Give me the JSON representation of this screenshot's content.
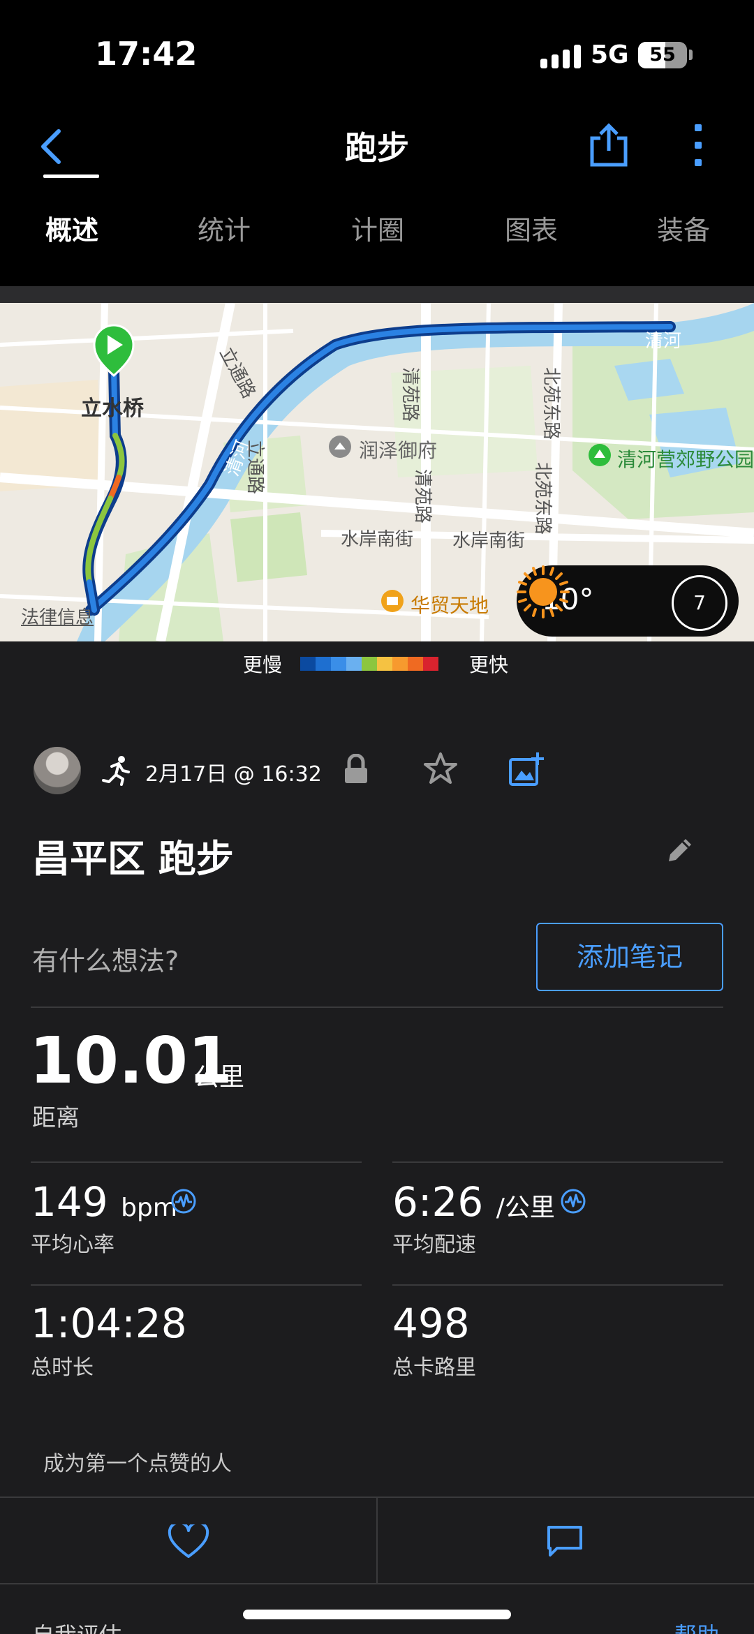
{
  "status_bar": {
    "time": "17:42",
    "network": "5G",
    "battery": "55",
    "battery_level": 0.55
  },
  "header": {
    "title": "跑步"
  },
  "tabs": [
    {
      "label": "概述",
      "active": true
    },
    {
      "label": "统计",
      "active": false
    },
    {
      "label": "计圈",
      "active": false
    },
    {
      "label": "图表",
      "active": false
    },
    {
      "label": "装备",
      "active": false
    }
  ],
  "map": {
    "labels": {
      "lishuiqiao": "立水桥",
      "litong_road": "立通路",
      "runze": "润泽御府",
      "qingyuan_road_1": "清苑路",
      "qingyuan_road_2": "清苑路",
      "beiyuan_east_road": "北苑东路",
      "beiyuan_east_road_2": "北苑东路",
      "qinghe_park": "清河营郊野公园",
      "shuian_south_1": "水岸南街",
      "shuian_south_2": "水岸南街",
      "huamao": "华贸天地",
      "qinghe_1": "清河",
      "qinghe_2": "清河",
      "legal": "法律信息",
      "litong_road_2": "立通路"
    },
    "weather": {
      "temperature": "10°",
      "icon": "sun-icon",
      "wind": "7"
    }
  },
  "legend": {
    "slower": "更慢",
    "faster": "更快",
    "colors": [
      "#0b4aa0",
      "#1e6fd0",
      "#3a8ee8",
      "#6ab0f0",
      "#8cc63f",
      "#f5c242",
      "#f79a2e",
      "#ef6a22",
      "#d9232e"
    ]
  },
  "activity": {
    "date": "2月17日 @ 16:32",
    "name": "昌平区 跑步",
    "thoughts_placeholder": "有什么想法?",
    "add_note_label": "添加笔记",
    "distance": {
      "value": "10.01",
      "unit": "公里",
      "label": "距离"
    },
    "stats": {
      "heart_rate": {
        "value": "149",
        "unit": "bpm",
        "label": "平均心率"
      },
      "pace": {
        "value": "6:26",
        "unit": "/公里",
        "label": "平均配速"
      },
      "duration": {
        "value": "1:04:28",
        "label": "总时长"
      },
      "calories": {
        "value": "498",
        "label": "总卡路里"
      }
    },
    "likes_text": "成为第一个点赞的人"
  },
  "footer": {
    "self_eval": "自我评估",
    "help": "帮助"
  },
  "colors": {
    "accent": "#4a9eff",
    "background": "#1c1c1e",
    "bar": "#000000"
  }
}
